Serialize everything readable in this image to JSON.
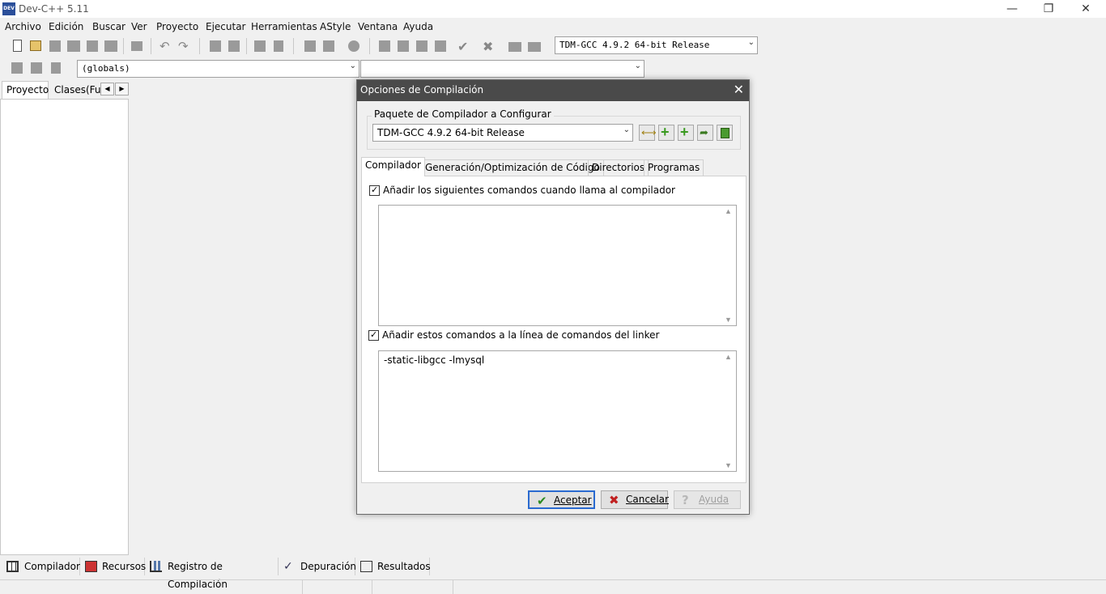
{
  "window": {
    "title": "Dev-C++ 5.11",
    "icon_text": "DEV"
  },
  "menu": [
    "Archivo",
    "Edición",
    "Buscar",
    "Ver",
    "Proyecto",
    "Ejecutar",
    "Herramientas",
    "AStyle",
    "Ventana",
    "Ayuda"
  ],
  "toolbar": {
    "compiler_combo": "TDM-GCC 4.9.2 64-bit Release",
    "scope_combo": "(globals)",
    "member_combo": ""
  },
  "left_panel": {
    "tabs": [
      "Proyecto",
      "Clases(Fun"
    ]
  },
  "bottom_tabs": [
    "Compilador",
    "Recursos",
    "Registro de Compilación",
    "Depuración",
    "Resultados"
  ],
  "dialog": {
    "title": "Opciones de Compilación",
    "group_label": "Paquete de Compilador a Configurar",
    "compiler_set": "TDM-GCC 4.9.2 64-bit Release",
    "tabs": [
      "Compilador",
      "Generación/Optimización de Código",
      "Directorios",
      "Programas"
    ],
    "active_tab": "Compilador",
    "compiler_cmds": {
      "label": "Añadir los siguientes comandos cuando llama al compilador",
      "checked": true,
      "value": ""
    },
    "linker_cmds": {
      "label": "Añadir estos comandos a la línea de comandos del linker",
      "checked": true,
      "value": "-static-libgcc -lmysql"
    },
    "buttons": {
      "ok": "Aceptar",
      "cancel": "Cancelar",
      "help": "Ayuda"
    }
  }
}
